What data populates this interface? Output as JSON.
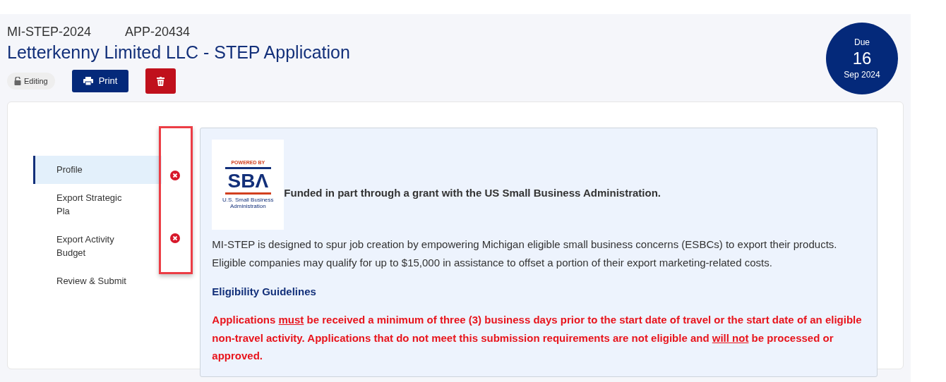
{
  "header": {
    "program": "MI-STEP-2024",
    "app_id": "APP-20434",
    "title": "Letterkenny Limited LLC - STEP Application",
    "status_badge": "Editing",
    "print_button": "Print",
    "due": {
      "label": "Due",
      "day": "16",
      "month_year": "Sep 2024"
    }
  },
  "sidebar": {
    "items": [
      {
        "label": "Profile",
        "selected": true,
        "error": true
      },
      {
        "label": "Export Strategic Pla",
        "selected": false,
        "error": false
      },
      {
        "label": "Export Activity Budget",
        "selected": false,
        "error": true
      },
      {
        "label": "Review & Submit",
        "selected": false,
        "error": false
      }
    ]
  },
  "info_panel": {
    "logo": {
      "top": "POWERED BY",
      "mark": "SBΛ",
      "bottom": "U.S. Small Business Administration"
    },
    "funding_note": "Funded in part through a grant with the US Small Business Administration.",
    "description": "MI-STEP is designed to spur job creation by empowering Michigan eligible small business concerns (ESBCs) to export their products. Eligible companies may qualify for up to $15,000 in assistance to offset a portion of their export marketing-related costs.",
    "guidelines_heading": "Eligibility Guidelines",
    "warning": [
      {
        "text": "Applications ",
        "underline": false
      },
      {
        "text": "must",
        "underline": true
      },
      {
        "text": " be received a minimum of three (3) business days prior to the start date of travel or the start date of an eligible non-travel activity. Applications that do not meet this submission requirements are not eligible and ",
        "underline": false
      },
      {
        "text": "will not",
        "underline": true
      },
      {
        "text": " be processed or approved.",
        "underline": false
      }
    ]
  }
}
